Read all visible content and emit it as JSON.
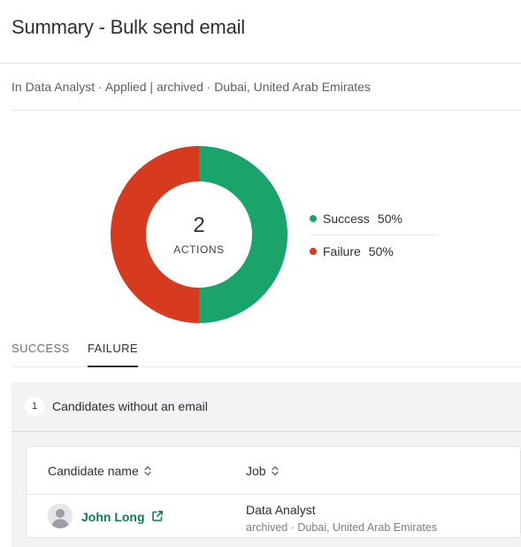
{
  "header": {
    "title": "Summary - Bulk send email"
  },
  "subline": "In Data Analyst · Applied | archived · Dubai, United Arab Emirates",
  "summary": {
    "count": "2",
    "count_label": "ACTIONS",
    "legend": [
      {
        "label": "Success",
        "pct": "50%",
        "color": "#1aa36a"
      },
      {
        "label": "Failure",
        "pct": "50%",
        "color": "#d63a1f"
      }
    ]
  },
  "chart_data": {
    "type": "pie",
    "categories": [
      "Success",
      "Failure"
    ],
    "values": [
      50,
      50
    ],
    "colors": [
      "#1aa36a",
      "#d63a1f"
    ]
  },
  "tabs": [
    {
      "label": "SUCCESS",
      "active": false
    },
    {
      "label": "FAILURE",
      "active": true
    }
  ],
  "failure_group": {
    "count": "1",
    "title": "Candidates without an email"
  },
  "table": {
    "columns": [
      "Candidate name",
      "Job"
    ],
    "rows": [
      {
        "name": "John Long",
        "job": "Data Analyst",
        "job_meta": "archived · Dubai, United Arab Emirates"
      }
    ]
  },
  "icons": {
    "sort": "sort-icon",
    "external": "external-link-icon",
    "avatar": "user-avatar-icon"
  }
}
